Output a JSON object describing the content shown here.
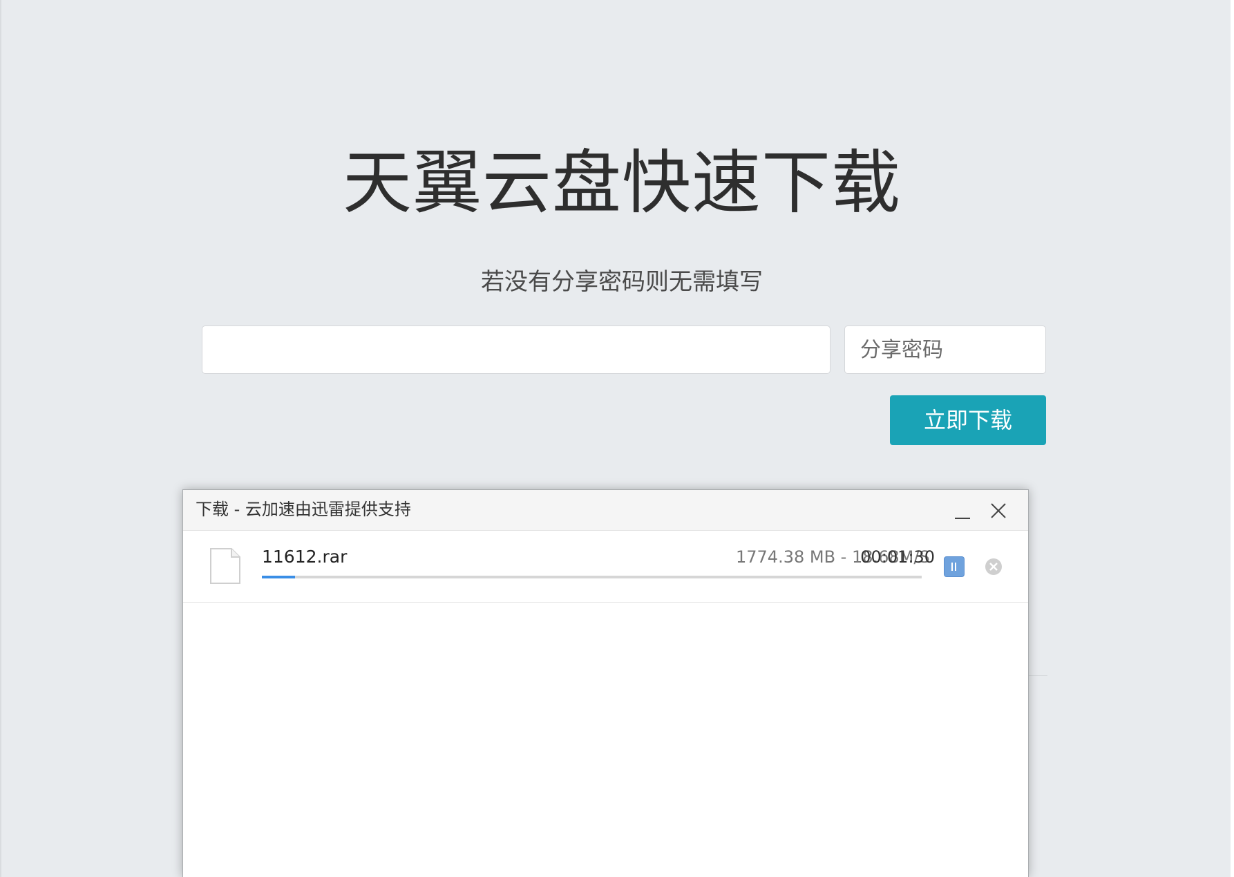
{
  "page": {
    "title": "天翼云盘快速下载",
    "subtitle": "若没有分享密码则无需填写"
  },
  "form": {
    "url_value": "",
    "password_placeholder": "分享密码",
    "download_label": "立即下载"
  },
  "dialog": {
    "title": "下载 - 云加速由迅雷提供支持",
    "items": [
      {
        "file_name": "11612.rar",
        "size": "1774.38 MB",
        "speed": "18.68M/S",
        "stats": "1774.38 MB - 18.68M/S",
        "time_left": "00:01:30",
        "progress_fraction": 0.05
      }
    ]
  },
  "colors": {
    "background": "#e8ebee",
    "accent": "#1aa3b6",
    "progress": "#3a8ee6",
    "pause_button": "#6fa2dd"
  },
  "icons": {
    "file": "file-icon",
    "pause": "pause-icon",
    "cancel": "cancel-circle-icon",
    "minimize": "minimize-icon",
    "close": "close-icon"
  }
}
